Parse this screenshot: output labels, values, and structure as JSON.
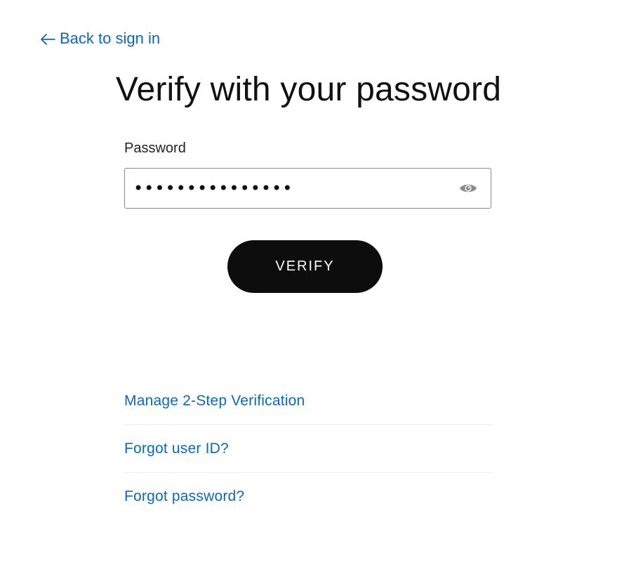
{
  "back_link": {
    "label": "Back to sign in"
  },
  "title": "Verify with your password",
  "password": {
    "label": "Password",
    "value": "•••••••••••••••",
    "icon": "eye-icon"
  },
  "verify_button": {
    "label": "VERIFY"
  },
  "links": [
    {
      "label": "Manage 2-Step Verification"
    },
    {
      "label": "Forgot user ID?"
    },
    {
      "label": "Forgot password?"
    }
  ],
  "colors": {
    "link": "#0b67c2",
    "button_bg": "#0d0d0d",
    "button_text": "#ffffff",
    "input_border": "#8a8a8a",
    "icon": "#8a8a8a"
  }
}
